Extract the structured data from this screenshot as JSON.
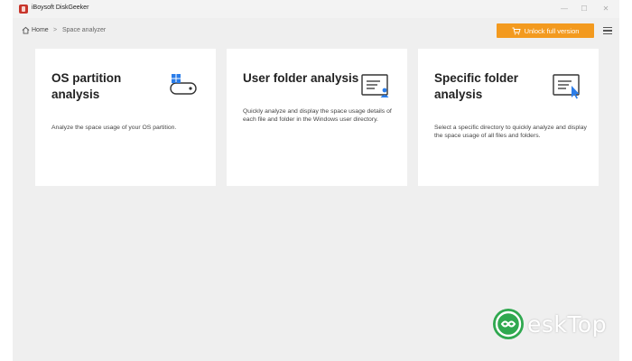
{
  "window": {
    "title": "iBoysoft DiskGeeker",
    "min_glyph": "—",
    "max_glyph": "☐",
    "close_glyph": "✕"
  },
  "breadcrumb": {
    "home": "Home",
    "separator": ">",
    "current": "Space analyzer"
  },
  "toolbar": {
    "unlock_label": "Unlock full version"
  },
  "cards": [
    {
      "title": "OS partition analysis",
      "description": "Analyze the space usage of your OS partition.",
      "icon": "disk-partition-icon"
    },
    {
      "title": "User folder analysis",
      "description": "Quickly analyze and display the space usage details of each file and folder in the Windows user directory.",
      "icon": "user-folder-icon"
    },
    {
      "title": "Specific folder analysis",
      "description": "Select a specific directory to quickly analyze and display the space usage of all files and folders.",
      "icon": "folder-select-icon"
    }
  ],
  "watermark": {
    "text": "eskTop"
  },
  "colors": {
    "accent": "#f39a1f",
    "icon_blue": "#2b7de9",
    "background": "#efefef",
    "card": "#ffffff",
    "watermark_green": "#2fa84f"
  }
}
